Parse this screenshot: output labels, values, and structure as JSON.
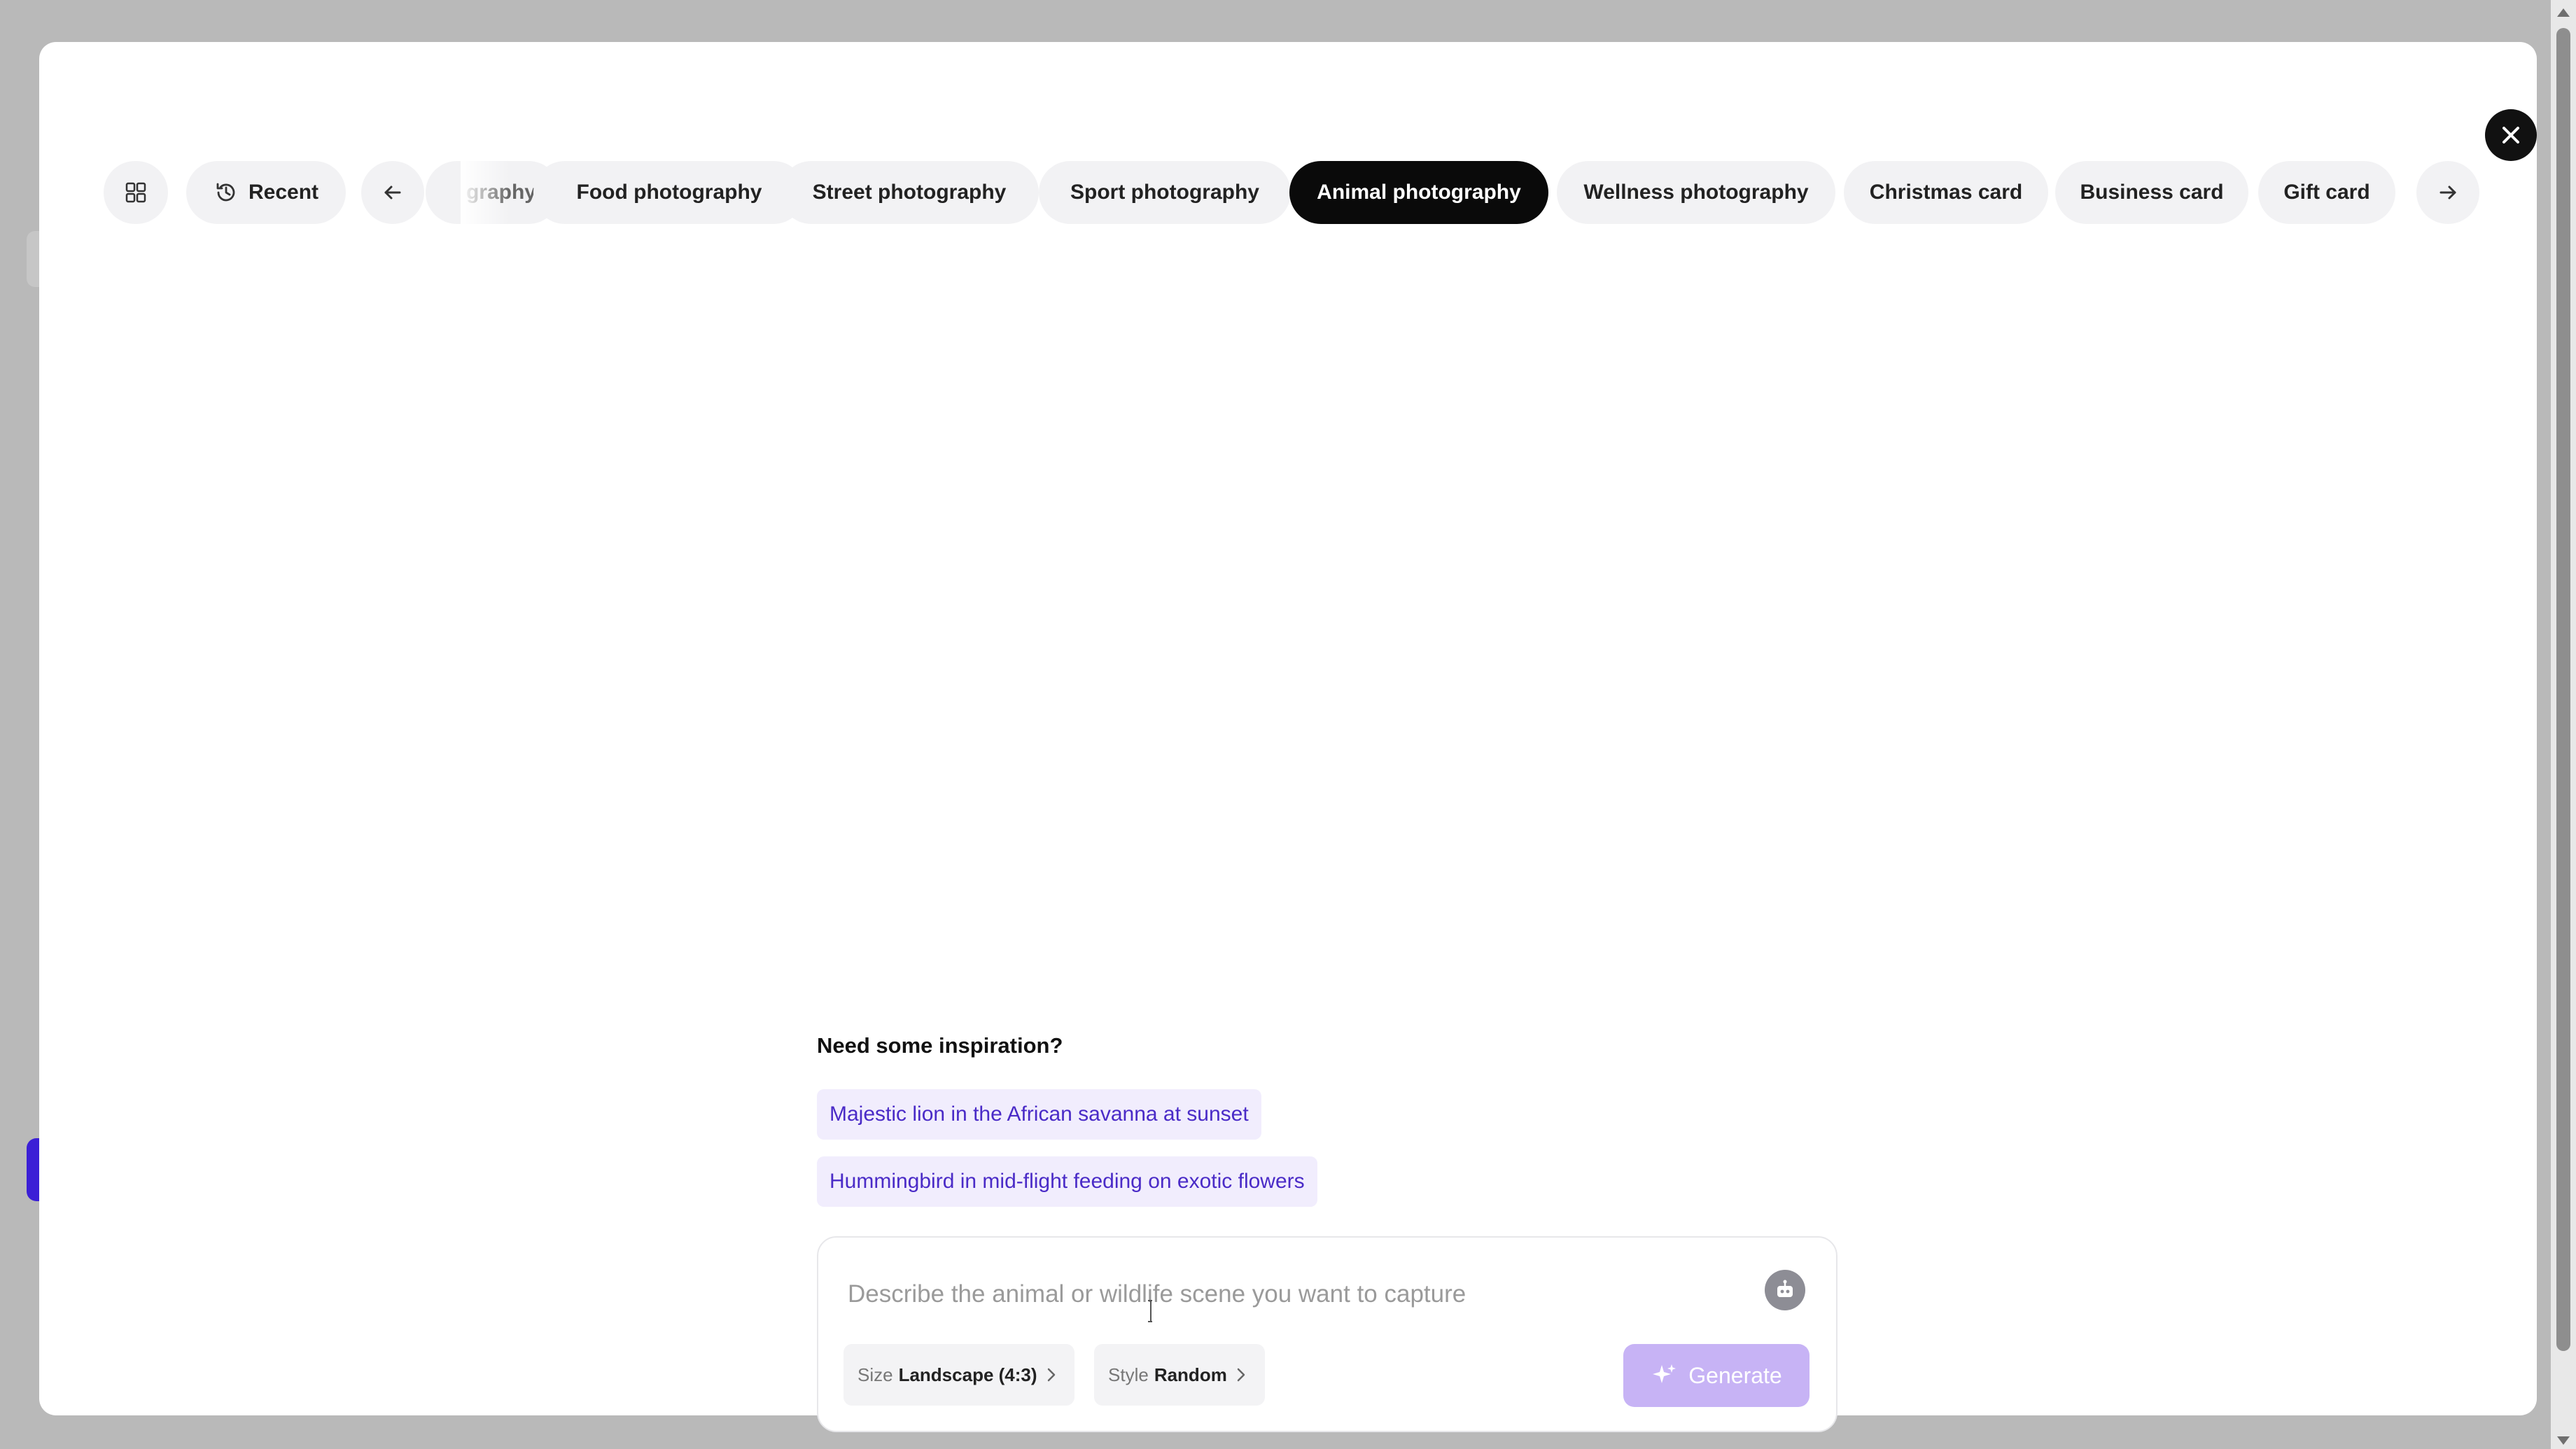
{
  "categories": {
    "recent_label": "Recent",
    "clipped_label": "graphy",
    "items": [
      "Food photography",
      "Street photography",
      "Sport photography",
      "Animal photography",
      "Wellness photography",
      "Christmas card",
      "Business card",
      "Gift card"
    ],
    "active": "Animal photography"
  },
  "inspiration": {
    "title": "Need some inspiration?",
    "suggestions": [
      "Majestic lion in the African savanna at sunset",
      "Hummingbird in mid-flight feeding on exotic flowers"
    ]
  },
  "prompt": {
    "placeholder": "Describe the animal or wildlife scene you want to capture",
    "value": "",
    "size_key": "Size",
    "size_value": "Landscape (4:3)",
    "style_key": "Style",
    "style_value": "Random",
    "generate_label": "Generate"
  },
  "colors": {
    "accent": "#4a2bc7",
    "generate_disabled": "#c7b3f5",
    "active_chip": "#0a0a0a"
  },
  "icons": {
    "grid": "grid-icon",
    "history": "history-icon",
    "back": "arrow-left-icon",
    "forward": "arrow-right-icon",
    "close": "close-icon",
    "robot": "robot-icon",
    "sparkle": "sparkle-icon"
  }
}
